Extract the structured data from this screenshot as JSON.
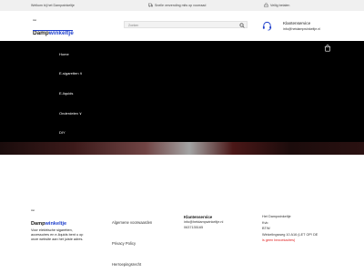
{
  "topbar": {
    "welcome": "Welkom bij het Dampwinkeltje",
    "shipping": "Snelle verzending mits op voorraad",
    "secure": "Veilig betalen"
  },
  "logo": {
    "top_small": "Het",
    "part1": "Damp",
    "part2": "winkeltje"
  },
  "search": {
    "placeholder": "Zoeken"
  },
  "service": {
    "title": "Klantenservice",
    "email": "info@hetdampwinkeltje.nl"
  },
  "nav": {
    "items": [
      {
        "label": "Home"
      },
      {
        "label": "E-sigaretten  ∨"
      },
      {
        "label": "E-liquids"
      },
      {
        "label": "Onderdelen  ∨"
      },
      {
        "label": "DIY"
      }
    ]
  },
  "footer": {
    "logo_small": "Het",
    "logo_part1": "Damp",
    "logo_part2": "winkeltje",
    "description": "Voor elektrische sigaretten, accessoires en e-liquids bent u op onze website aan het juiste adres.",
    "links": [
      {
        "label": "Algemene voorwaarden"
      },
      {
        "label": "Privacy Policy"
      },
      {
        "label": "Herroepingsrecht"
      }
    ],
    "service_title": "Klantenservice",
    "service_email": "info@hetdampwinkeltje.nl",
    "service_phone": "0637135165",
    "address": {
      "name": "Het Dampwinkeltje",
      "line2": "Kvk:",
      "line3": "BTW:",
      "line4": "Winkelingsweg 10 A16 (LET OP! DE",
      "line5": "is geen bezoekadres)"
    }
  },
  "colors": {
    "brand_blue": "#1e3fcc",
    "hero_bg": "#000000",
    "alert_red": "#e02020"
  },
  "icons": {
    "shipping": "truck-icon",
    "secure": "lock-icon",
    "search": "search-icon",
    "service": "headset-icon",
    "cart": "cart-icon"
  }
}
